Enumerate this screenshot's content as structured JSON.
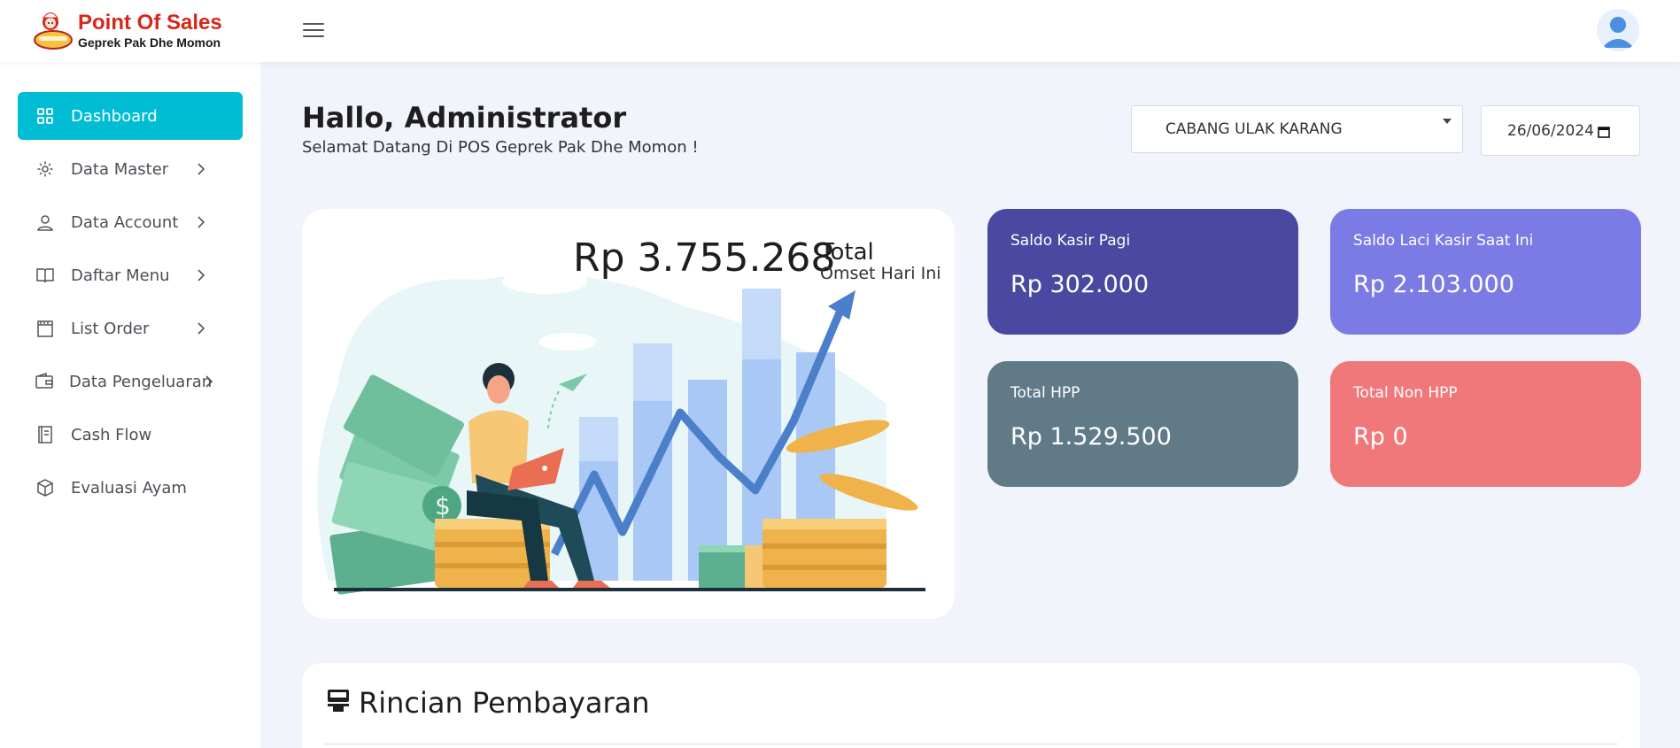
{
  "app": {
    "title": "Point Of Sales",
    "subtitle": "Geprek Pak Dhe Momon"
  },
  "sidebar": {
    "items": [
      {
        "label": "Dashboard",
        "icon": "grid-icon",
        "active": true,
        "has_children": false
      },
      {
        "label": "Data Master",
        "icon": "gear-icon",
        "active": false,
        "has_children": true
      },
      {
        "label": "Data Account",
        "icon": "user-icon",
        "active": false,
        "has_children": true
      },
      {
        "label": "Daftar Menu",
        "icon": "book-icon",
        "active": false,
        "has_children": true
      },
      {
        "label": "List Order",
        "icon": "calendar-icon",
        "active": false,
        "has_children": true
      },
      {
        "label": "Data Pengeluaran",
        "icon": "wallet-icon",
        "active": false,
        "has_children": true
      },
      {
        "label": "Cash Flow",
        "icon": "ledger-icon",
        "active": false,
        "has_children": false
      },
      {
        "label": "Evaluasi Ayam",
        "icon": "box-icon",
        "active": false,
        "has_children": false
      }
    ]
  },
  "greeting": {
    "title": "Hallo, Administrator",
    "subtitle": "Selamat Datang Di POS Geprek Pak Dhe Momon !"
  },
  "filters": {
    "branch": "CABANG ULAK KARANG",
    "date": "26/06/2024"
  },
  "hero": {
    "amount": "Rp 3.755.268",
    "total_label": "Total",
    "omset_label": "Omset Hari Ini"
  },
  "stats": [
    {
      "label": "Saldo Kasir Pagi",
      "value": "Rp 302.000",
      "color": "#4a48a0"
    },
    {
      "label": "Saldo Laci Kasir Saat Ini",
      "value": "Rp 2.103.000",
      "color": "#7b7be6"
    },
    {
      "label": "Total HPP",
      "value": "Rp 1.529.500",
      "color": "#617a88"
    },
    {
      "label": "Total Non HPP",
      "value": "Rp 0",
      "color": "#f0787a"
    }
  ],
  "payments": {
    "title": "Rincian Pembayaran"
  },
  "colors": {
    "accent": "#00bcd4",
    "brand_red": "#d7261b",
    "background": "#f2f4fb"
  }
}
